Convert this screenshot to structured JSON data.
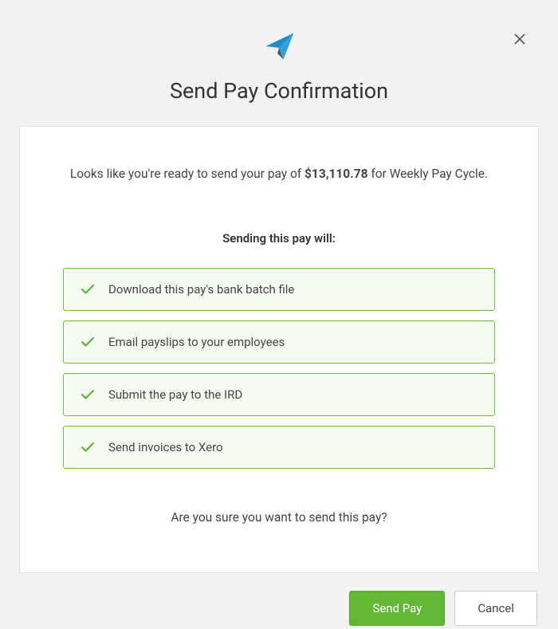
{
  "header": {
    "title": "Send Pay Confirmation"
  },
  "intro": {
    "prefix": "Looks like you're ready to send your pay of ",
    "amount": "$13,110.78",
    "suffix": " for Weekly Pay Cycle."
  },
  "subtitle": "Sending this pay will:",
  "actions": {
    "0": "Download this pay's bank batch file",
    "1": "Email payslips to your employees",
    "2": "Submit the pay to the IRD",
    "3": "Send invoices to Xero"
  },
  "confirm_text": "Are you sure you want to send this pay?",
  "buttons": {
    "send": "Send Pay",
    "cancel": "Cancel"
  }
}
